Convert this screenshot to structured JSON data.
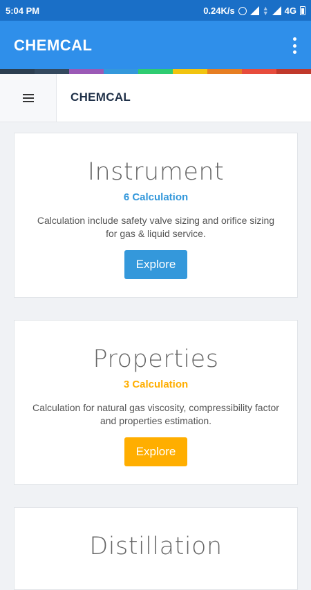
{
  "status_bar": {
    "time": "5:04 PM",
    "network_speed": "0.24K/s",
    "network_type": "4G",
    "icons": [
      "alarm-icon",
      "signal-icon",
      "data-arrows-icon",
      "signal-icon",
      "battery-icon"
    ]
  },
  "app_bar": {
    "title": "CHEMCAL",
    "overflow_icon": "more-vert-icon"
  },
  "color_strip": [
    "#2c3e50",
    "#34495e",
    "#9b59b6",
    "#3498db",
    "#2ecc71",
    "#f1c40f",
    "#e67e22",
    "#e74c3c",
    "#c0392b"
  ],
  "nav": {
    "menu_icon": "hamburger-icon",
    "brand": "CHEMCAL"
  },
  "cards": [
    {
      "title": "Instrument",
      "count": "6 Calculation",
      "description": "Calculation include safety valve sizing and orifice sizing for gas & liquid service.",
      "button_label": "Explore",
      "accent": "#3498db"
    },
    {
      "title": "Properties",
      "count": "3 Calculation",
      "description": "Calculation for natural gas viscosity, compressibility factor and properties estimation.",
      "button_label": "Explore",
      "accent": "#ffae00"
    },
    {
      "title": "Distillation",
      "accent": "#2ecc71"
    }
  ]
}
